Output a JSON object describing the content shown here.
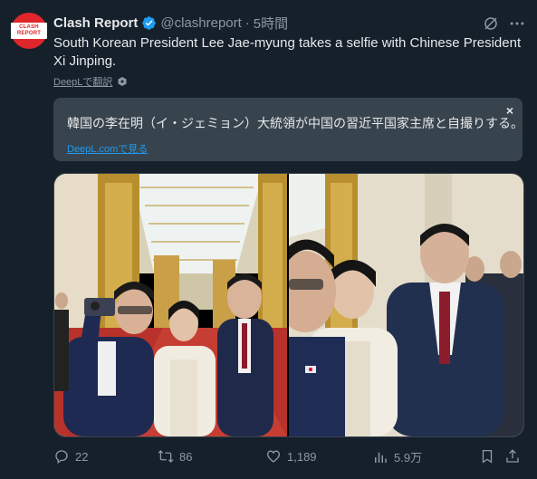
{
  "author": {
    "name": "Clash Report",
    "handle": "@clashreport",
    "time": "5時間",
    "separator": "·",
    "avatar_text": "CLASH REPORT",
    "avatar_icon": "clash-report-logo"
  },
  "tweet": {
    "text": "South Korean President Lee Jae-myung takes a selfie with Chinese President Xi Jinping.",
    "translate_label": "DeepLで翻訳"
  },
  "translation": {
    "text": "韓国の李在明（イ・ジェミョン）大統領が中国の習近平国家主席と自撮りする。",
    "link_label": "DeepL.comで見る",
    "close": "×"
  },
  "media": {
    "images": [
      {
        "description_icon": "selfie-photo-wide"
      },
      {
        "description_icon": "selfie-photo-close"
      }
    ]
  },
  "actions": {
    "reply_count": "22",
    "repost_count": "86",
    "like_count": "1,189",
    "views_count": "5.9万"
  },
  "colors": {
    "background": "#15202b",
    "text": "#e7e9ea",
    "muted": "#8b98a5",
    "link": "#1d9bf0",
    "verified": "#1d9bf0",
    "translation_bg": "#38444d",
    "brand": "#e0262a"
  }
}
